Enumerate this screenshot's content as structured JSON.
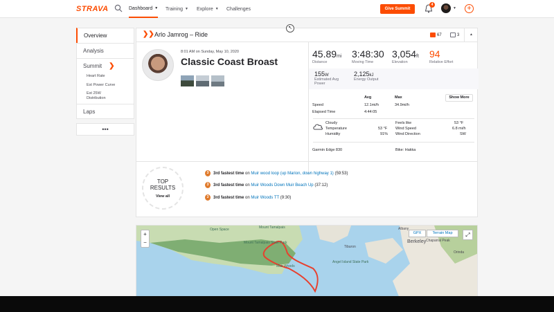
{
  "topbar": {
    "logo": "STRAVA",
    "nav": [
      {
        "label": "Dashboard"
      },
      {
        "label": "Training"
      },
      {
        "label": "Explore"
      },
      {
        "label": "Challenges"
      }
    ],
    "give_summit": "Give Summit",
    "notification_count": "4"
  },
  "sidebar": {
    "overview": "Overview",
    "analysis": "Analysis",
    "summit": "Summit",
    "sub_items": [
      "Heart Rate",
      "Est Power Curve",
      "Est 25W",
      "Distribution"
    ],
    "laps": "Laps",
    "more": "•••"
  },
  "activity": {
    "header_title": "Arlo Jamrog – Ride",
    "kudos": "67",
    "comments": "3",
    "date": "8:01 AM on Sunday, May 10, 2020",
    "name": "Classic Coast Broast",
    "stats": {
      "distance_val": "45.89",
      "distance_unit": "mi",
      "distance_lbl": "Distance",
      "moving_val": "3:48:30",
      "moving_lbl": "Moving Time",
      "elev_val": "3,054",
      "elev_unit": "ft",
      "elev_lbl": "Elevation",
      "effort_val": "94",
      "effort_lbl": "Relative Effort",
      "power_val": "155",
      "power_unit": "W",
      "power_lbl1": "Estimated Avg",
      "power_lbl2": "Power",
      "energy_val": "2,125",
      "energy_unit": "kJ",
      "energy_lbl": "Energy Output"
    },
    "table": {
      "avg": "Avg",
      "max": "Max",
      "show_more": "Show More",
      "speed_lbl": "Speed",
      "speed_avg": "12.1mi/h",
      "speed_max": "34.9mi/h",
      "elapsed_lbl": "Elapsed Time",
      "elapsed_val": "4:44:05"
    },
    "weather": {
      "cond": "Cloudy",
      "temp_lbl": "Temperature",
      "temp_val": "53 °F",
      "hum_lbl": "Humidity",
      "hum_val": "91%",
      "feels_lbl": "Feels like",
      "feels_val": "53 °F",
      "wind_lbl": "Wind Speed",
      "wind_val": "6.8 mi/h",
      "dir_lbl": "Wind Direction",
      "dir_val": "SW"
    },
    "device": "Garmin Edge 830",
    "bike": "Bike: Hakka",
    "top_results": {
      "title1": "TOP",
      "title2": "RESULTS",
      "view_all": "View all"
    },
    "results": [
      {
        "medal": "3",
        "bold": "3rd fastest time",
        "on": "on",
        "seg": "Muir wood loop (up Marion, down highway 1)",
        "time": "(59:53)"
      },
      {
        "medal": "3",
        "bold": "3rd fastest time",
        "on": "on",
        "seg": "Muir Woods Down Muir Beach Up",
        "time": "(37:12)"
      },
      {
        "medal": "3",
        "bold": "3rd fastest time",
        "on": "on",
        "seg": "Muir Woods TT",
        "time": "(9:30)"
      }
    ]
  },
  "map": {
    "zoom_in": "+",
    "zoom_out": "−",
    "gpx": "GPX",
    "terrain": "Terrain Map",
    "labels": [
      "Open Space",
      "Mount Tamalpais",
      "Mount Tamalpais State Park",
      "Muir Woods",
      "Angel Island State Park",
      "Berkeley",
      "Orinda",
      "Chaparral Peak",
      "Albany",
      "Tiburon"
    ]
  },
  "colors": {
    "brand": "#fc4c02",
    "link": "#0073bb"
  }
}
